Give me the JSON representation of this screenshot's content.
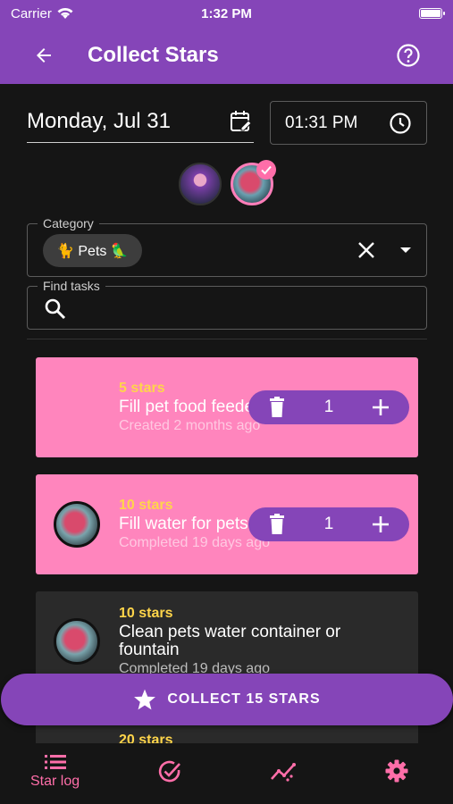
{
  "status_bar": {
    "carrier": "Carrier",
    "time": "1:32 PM"
  },
  "app_bar": {
    "title": "Collect Stars"
  },
  "date_field": {
    "value": "Monday, Jul 31"
  },
  "time_field": {
    "value": "01:31 PM"
  },
  "category": {
    "label": "Category",
    "chip_text": "🐈 Pets 🦜"
  },
  "find": {
    "label": "Find tasks",
    "placeholder": ""
  },
  "tasks": [
    {
      "stars": "5 stars",
      "title": "Fill pet food feeder",
      "subtitle": "Created 2 months ago",
      "count": "1"
    },
    {
      "stars": "10 stars",
      "title": "Fill water for pets",
      "subtitle": "Completed 19 days ago",
      "count": "1"
    },
    {
      "stars": "10 stars",
      "title": "Clean pets water container or fountain",
      "subtitle": "Completed 19 days ago"
    },
    {
      "stars": "20 stars"
    }
  ],
  "collect_button": {
    "label": "COLLECT 15 STARS"
  },
  "bottom_nav": {
    "items": [
      {
        "label": "Star log",
        "icon": "list-icon"
      },
      {
        "icon": "check-circle-icon"
      },
      {
        "icon": "chart-icon"
      },
      {
        "icon": "gear-icon"
      }
    ]
  },
  "colors": {
    "primary": "#8545b8",
    "accent_pink": "#ff85bd",
    "stars_yellow": "#ffd54a"
  }
}
